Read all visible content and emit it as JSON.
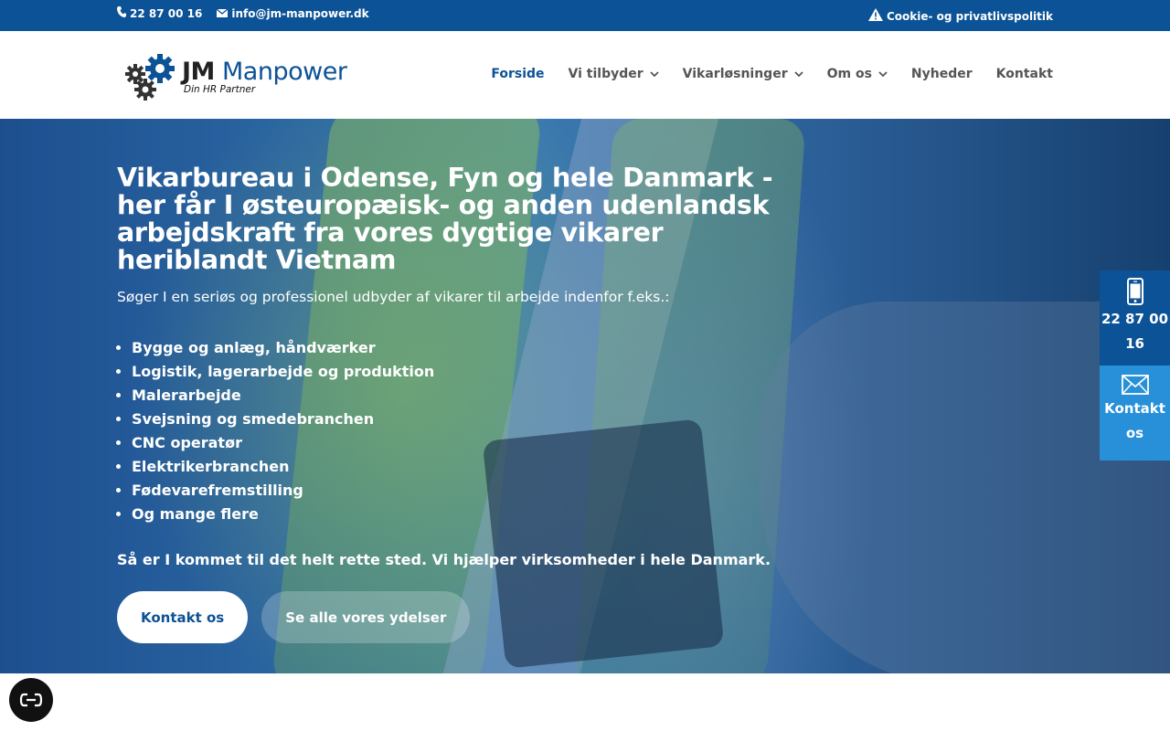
{
  "topbar": {
    "phone": "22 87 00 16",
    "email": "info@jm-manpower.dk",
    "cookie_link": "Cookie- og privatlivspolitik"
  },
  "logo": {
    "brand_bold": "JM",
    "brand_light": "Manpower",
    "tagline": "Din HR Partner"
  },
  "nav": {
    "items": [
      {
        "label": "Forside",
        "active": true,
        "dropdown": false
      },
      {
        "label": "Vi tilbyder",
        "active": false,
        "dropdown": true
      },
      {
        "label": "Vikarløsninger",
        "active": false,
        "dropdown": true
      },
      {
        "label": "Om os",
        "active": false,
        "dropdown": true
      },
      {
        "label": "Nyheder",
        "active": false,
        "dropdown": false
      },
      {
        "label": "Kontakt",
        "active": false,
        "dropdown": false
      }
    ]
  },
  "hero": {
    "title": "Vikarbureau i Odense, Fyn og hele Danmark - her får I østeuropæisk- og anden udenlandsk arbejdskraft fra vores dygtige vikarer heriblandt Vietnam",
    "intro": "Søger I en seriøs og professionel udbyder af vikarer til arbejde indenfor f.eks.:",
    "list": [
      "Bygge og anlæg, håndværker",
      "Logistik, lagerarbejde og produktion",
      "Malerarbejde",
      "Svejsning og smedebranchen",
      "CNC operatør",
      "Elektrikerbranchen",
      "Fødevarefremstilling",
      "Og mange flere"
    ],
    "outro": "Så er I kommet til det helt rette sted. Vi hjælper virksomheder i hele Danmark.",
    "button_primary": "Kontakt os",
    "button_secondary": "Se alle vores ydelser"
  },
  "sticky": {
    "phone": "22 87 00 16",
    "contact": "Kontakt os"
  },
  "colors": {
    "brand_blue": "#0c5296",
    "light_blue": "#2890d8"
  }
}
